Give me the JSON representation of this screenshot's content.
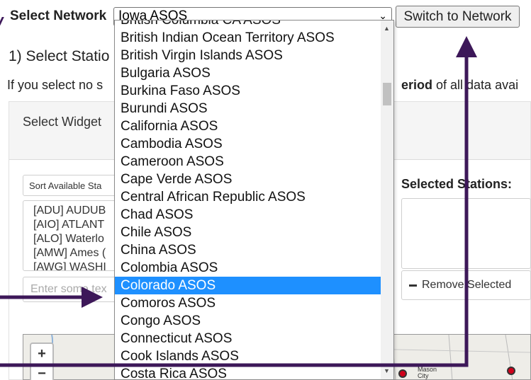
{
  "header": {
    "select_label": "Select Network",
    "selected_network": "Iowa ASOS",
    "switch_button": "Switch to Network"
  },
  "step_title": "1) Select Statio",
  "help": {
    "left": "If you select no s",
    "right_bold": "eriod",
    "right_rest": " of all data avai"
  },
  "widget": {
    "label": "Select Widget"
  },
  "left_panel": {
    "sort_label": "Sort Available Sta",
    "stations": [
      "[ADU] AUDUB",
      "[AIO] ATLANT",
      "[ALO] Waterlo",
      "[AMW] Ames (",
      "[AWG] WASHI"
    ],
    "filter_placeholder": "Enter some tex"
  },
  "right_panel": {
    "selected_title": "Selected Stations:",
    "remove_button": "Remove Selected"
  },
  "dropdown": {
    "options": [
      "British Columbia CA ASOS",
      "British Indian Ocean Territory ASOS",
      "British Virgin Islands ASOS",
      "Bulgaria ASOS",
      "Burkina Faso ASOS",
      "Burundi ASOS",
      "California ASOS",
      "Cambodia ASOS",
      "Cameroon ASOS",
      "Cape Verde ASOS",
      "Central African Republic ASOS",
      "Chad ASOS",
      "Chile ASOS",
      "China ASOS",
      "Colombia ASOS",
      "Colorado ASOS",
      "Comoros ASOS",
      "Congo ASOS",
      "Connecticut ASOS",
      "Cook Islands ASOS",
      "Costa Rica ASOS"
    ],
    "highlighted": "Colorado ASOS"
  },
  "map": {
    "zoom_in": "+",
    "zoom_out": "−",
    "city_label_1": "Mason",
    "city_label_2": "City"
  },
  "colors": {
    "highlight": "#1e90ff",
    "annotation_arrow": "#3d1859",
    "station_dot": "#d0021b"
  },
  "icons": {
    "dropdown_caret": "chevron-down-icon",
    "remove": "minus-icon",
    "scroll_up": "triangle-up-icon",
    "scroll_down": "triangle-down-icon"
  }
}
